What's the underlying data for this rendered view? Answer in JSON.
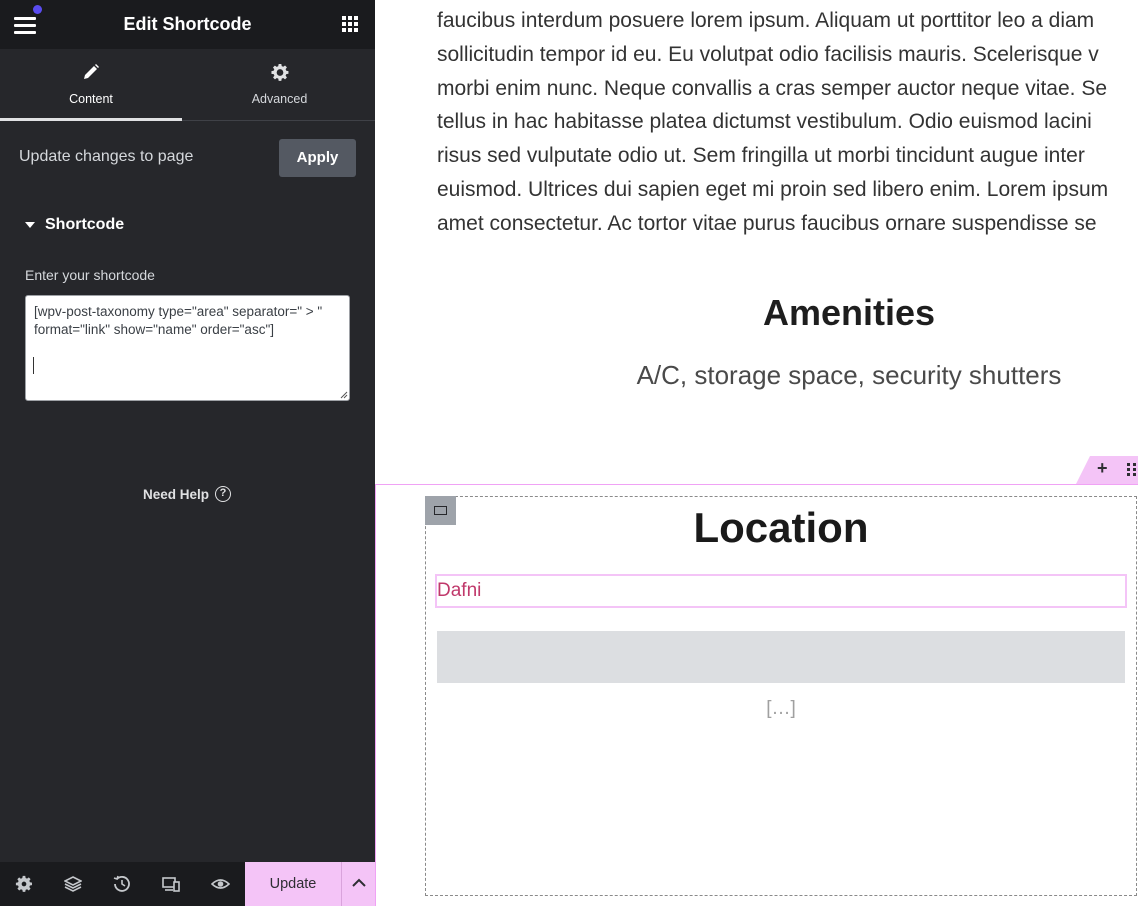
{
  "panel": {
    "title": "Edit Shortcode",
    "tabs": [
      {
        "label": "Content",
        "icon": "pencil-icon",
        "active": true
      },
      {
        "label": "Advanced",
        "icon": "gear-icon",
        "active": false
      }
    ],
    "update_row": {
      "label": "Update changes to page",
      "apply_label": "Apply"
    },
    "section": {
      "title": "Shortcode",
      "expanded": true
    },
    "shortcode": {
      "label": "Enter your shortcode",
      "value": "[wpv-post-taxonomy type=\"area\" separator=\" > \" format=\"link\" show=\"name\" order=\"asc\"]"
    },
    "need_help": "Need Help",
    "help_glyph": "?",
    "footer": {
      "icons": [
        "settings-icon",
        "layers-icon",
        "history-icon",
        "responsive-icon",
        "preview-eye-icon"
      ],
      "update_label": "Update"
    }
  },
  "preview": {
    "lorem_lines": [
      "faucibus interdum posuere lorem ipsum. Aliquam ut porttitor leo a diam",
      "sollicitudin tempor id eu. Eu volutpat odio facilisis mauris. Scelerisque v",
      "morbi enim nunc. Neque convallis a cras semper auctor neque vitae. Se",
      "tellus in hac habitasse platea dictumst vestibulum. Odio euismod lacini",
      "risus sed vulputate odio ut. Sem fringilla ut morbi tincidunt augue inter",
      "euismod. Ultrices dui sapien eget mi proin sed libero enim. Lorem ipsum",
      "amet consectetur. Ac tortor vitae purus faucibus ornare suspendisse se"
    ],
    "amenities_title": "Amenities",
    "amenities_text": "A/C, storage space, security shutters",
    "section_add": "+",
    "location_title": "Location",
    "location_value": "Dafni",
    "excerpt": "[…]"
  },
  "colors": {
    "panel_bg": "#26272b",
    "header_bg": "#1a1b1e",
    "accent_pink": "#f4c4f7",
    "link_color": "#c0396b",
    "notification_dot": "#5a4cf0"
  }
}
